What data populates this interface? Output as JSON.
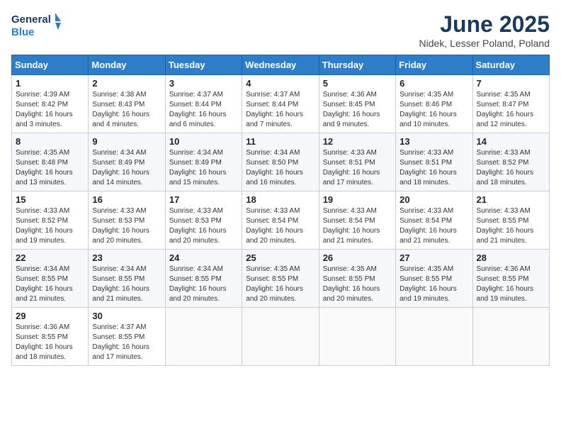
{
  "header": {
    "logo_line1": "General",
    "logo_line2": "Blue",
    "month_title": "June 2025",
    "subtitle": "Nidek, Lesser Poland, Poland"
  },
  "days_of_week": [
    "Sunday",
    "Monday",
    "Tuesday",
    "Wednesday",
    "Thursday",
    "Friday",
    "Saturday"
  ],
  "weeks": [
    [
      {
        "day": "1",
        "info": "Sunrise: 4:39 AM\nSunset: 8:42 PM\nDaylight: 16 hours\nand 3 minutes."
      },
      {
        "day": "2",
        "info": "Sunrise: 4:38 AM\nSunset: 8:43 PM\nDaylight: 16 hours\nand 4 minutes."
      },
      {
        "day": "3",
        "info": "Sunrise: 4:37 AM\nSunset: 8:44 PM\nDaylight: 16 hours\nand 6 minutes."
      },
      {
        "day": "4",
        "info": "Sunrise: 4:37 AM\nSunset: 8:44 PM\nDaylight: 16 hours\nand 7 minutes."
      },
      {
        "day": "5",
        "info": "Sunrise: 4:36 AM\nSunset: 8:45 PM\nDaylight: 16 hours\nand 9 minutes."
      },
      {
        "day": "6",
        "info": "Sunrise: 4:35 AM\nSunset: 8:46 PM\nDaylight: 16 hours\nand 10 minutes."
      },
      {
        "day": "7",
        "info": "Sunrise: 4:35 AM\nSunset: 8:47 PM\nDaylight: 16 hours\nand 12 minutes."
      }
    ],
    [
      {
        "day": "8",
        "info": "Sunrise: 4:35 AM\nSunset: 8:48 PM\nDaylight: 16 hours\nand 13 minutes."
      },
      {
        "day": "9",
        "info": "Sunrise: 4:34 AM\nSunset: 8:49 PM\nDaylight: 16 hours\nand 14 minutes."
      },
      {
        "day": "10",
        "info": "Sunrise: 4:34 AM\nSunset: 8:49 PM\nDaylight: 16 hours\nand 15 minutes."
      },
      {
        "day": "11",
        "info": "Sunrise: 4:34 AM\nSunset: 8:50 PM\nDaylight: 16 hours\nand 16 minutes."
      },
      {
        "day": "12",
        "info": "Sunrise: 4:33 AM\nSunset: 8:51 PM\nDaylight: 16 hours\nand 17 minutes."
      },
      {
        "day": "13",
        "info": "Sunrise: 4:33 AM\nSunset: 8:51 PM\nDaylight: 16 hours\nand 18 minutes."
      },
      {
        "day": "14",
        "info": "Sunrise: 4:33 AM\nSunset: 8:52 PM\nDaylight: 16 hours\nand 18 minutes."
      }
    ],
    [
      {
        "day": "15",
        "info": "Sunrise: 4:33 AM\nSunset: 8:52 PM\nDaylight: 16 hours\nand 19 minutes."
      },
      {
        "day": "16",
        "info": "Sunrise: 4:33 AM\nSunset: 8:53 PM\nDaylight: 16 hours\nand 20 minutes."
      },
      {
        "day": "17",
        "info": "Sunrise: 4:33 AM\nSunset: 8:53 PM\nDaylight: 16 hours\nand 20 minutes."
      },
      {
        "day": "18",
        "info": "Sunrise: 4:33 AM\nSunset: 8:54 PM\nDaylight: 16 hours\nand 20 minutes."
      },
      {
        "day": "19",
        "info": "Sunrise: 4:33 AM\nSunset: 8:54 PM\nDaylight: 16 hours\nand 21 minutes."
      },
      {
        "day": "20",
        "info": "Sunrise: 4:33 AM\nSunset: 8:54 PM\nDaylight: 16 hours\nand 21 minutes."
      },
      {
        "day": "21",
        "info": "Sunrise: 4:33 AM\nSunset: 8:55 PM\nDaylight: 16 hours\nand 21 minutes."
      }
    ],
    [
      {
        "day": "22",
        "info": "Sunrise: 4:34 AM\nSunset: 8:55 PM\nDaylight: 16 hours\nand 21 minutes."
      },
      {
        "day": "23",
        "info": "Sunrise: 4:34 AM\nSunset: 8:55 PM\nDaylight: 16 hours\nand 21 minutes."
      },
      {
        "day": "24",
        "info": "Sunrise: 4:34 AM\nSunset: 8:55 PM\nDaylight: 16 hours\nand 20 minutes."
      },
      {
        "day": "25",
        "info": "Sunrise: 4:35 AM\nSunset: 8:55 PM\nDaylight: 16 hours\nand 20 minutes."
      },
      {
        "day": "26",
        "info": "Sunrise: 4:35 AM\nSunset: 8:55 PM\nDaylight: 16 hours\nand 20 minutes."
      },
      {
        "day": "27",
        "info": "Sunrise: 4:35 AM\nSunset: 8:55 PM\nDaylight: 16 hours\nand 19 minutes."
      },
      {
        "day": "28",
        "info": "Sunrise: 4:36 AM\nSunset: 8:55 PM\nDaylight: 16 hours\nand 19 minutes."
      }
    ],
    [
      {
        "day": "29",
        "info": "Sunrise: 4:36 AM\nSunset: 8:55 PM\nDaylight: 16 hours\nand 18 minutes."
      },
      {
        "day": "30",
        "info": "Sunrise: 4:37 AM\nSunset: 8:55 PM\nDaylight: 16 hours\nand 17 minutes."
      },
      {
        "day": "",
        "info": ""
      },
      {
        "day": "",
        "info": ""
      },
      {
        "day": "",
        "info": ""
      },
      {
        "day": "",
        "info": ""
      },
      {
        "day": "",
        "info": ""
      }
    ]
  ]
}
